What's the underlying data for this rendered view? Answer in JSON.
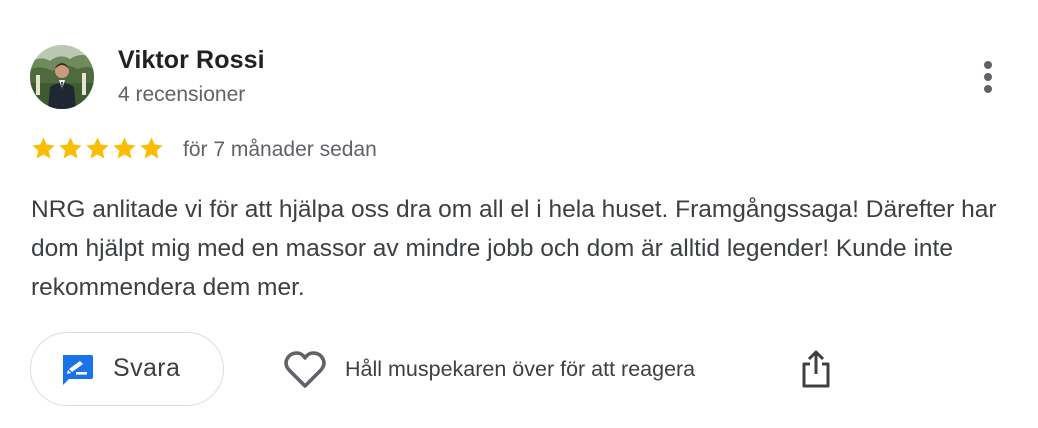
{
  "reviewer": {
    "name": "Viktor Rossi",
    "review_count": "4 recensioner",
    "avatar_icon": "profile-photo-icon"
  },
  "review": {
    "rating": 5,
    "max_rating": 5,
    "star_color": "#fbbc04",
    "time": "för 7 månader sedan",
    "text": "NRG anlitade vi för att hjälpa oss dra om all el i hela huset. Framgångssaga! Därefter har dom hjälpt mig med en massor av mindre jobb och dom är alltid legender! Kunde inte rekommendera dem mer."
  },
  "actions": {
    "reply_label": "Svara",
    "reply_icon": "reply-icon",
    "reply_icon_color": "#1a73e8",
    "react_icon": "heart-outline-icon",
    "react_hint": "Håll muspekaren över för att reagera",
    "share_icon": "share-icon",
    "more_icon": "more-vert-icon"
  }
}
